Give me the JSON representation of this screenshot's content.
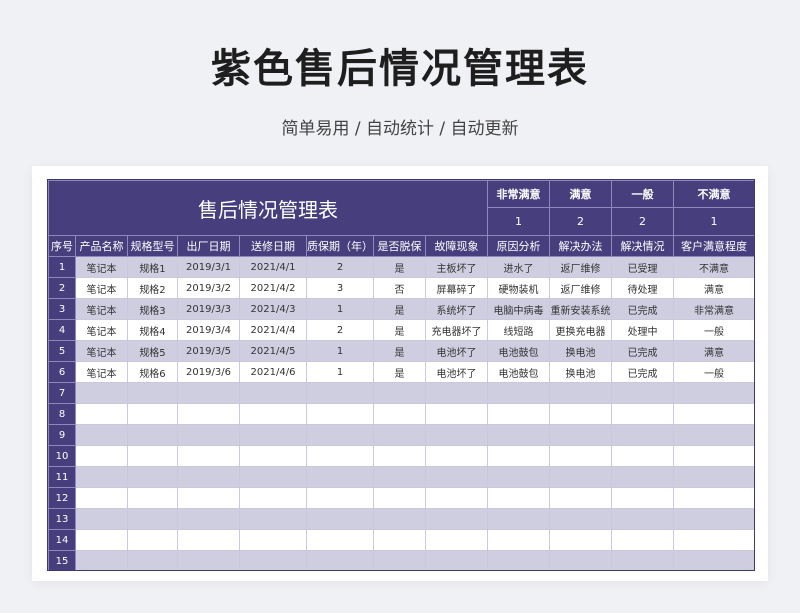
{
  "page": {
    "title": "紫色售后情况管理表",
    "subtitle": "简单易用 / 自动统计 / 自动更新"
  },
  "sheet": {
    "main_title": "售后情况管理表",
    "satisfaction": [
      {
        "label": "非常满意",
        "count": "1"
      },
      {
        "label": "满意",
        "count": "2"
      },
      {
        "label": "一般",
        "count": "2"
      },
      {
        "label": "不满意",
        "count": "1"
      }
    ],
    "columns": [
      "序号",
      "产品名称",
      "规格型号",
      "出厂日期",
      "送修日期",
      "质保期（年）",
      "是否脱保",
      "故障现象",
      "原因分析",
      "解决办法",
      "解决情况",
      "客户满意程度"
    ],
    "rows": [
      [
        "1",
        "笔记本",
        "规格1",
        "2019/3/1",
        "2021/4/1",
        "2",
        "是",
        "主板坏了",
        "进水了",
        "返厂维修",
        "已受理",
        "不满意"
      ],
      [
        "2",
        "笔记本",
        "规格2",
        "2019/3/2",
        "2021/4/2",
        "3",
        "否",
        "屏幕碎了",
        "硬物装机",
        "返厂维修",
        "待处理",
        "满意"
      ],
      [
        "3",
        "笔记本",
        "规格3",
        "2019/3/3",
        "2021/4/3",
        "1",
        "是",
        "系统坏了",
        "电脑中病毒",
        "重新安装系统",
        "已完成",
        "非常满意"
      ],
      [
        "4",
        "笔记本",
        "规格4",
        "2019/3/4",
        "2021/4/4",
        "2",
        "是",
        "充电器坏了",
        "线短路",
        "更换充电器",
        "处理中",
        "一般"
      ],
      [
        "5",
        "笔记本",
        "规格5",
        "2019/3/5",
        "2021/4/5",
        "1",
        "是",
        "电池坏了",
        "电池鼓包",
        "换电池",
        "已完成",
        "满意"
      ],
      [
        "6",
        "笔记本",
        "规格6",
        "2019/3/6",
        "2021/4/6",
        "1",
        "是",
        "电池坏了",
        "电池鼓包",
        "换电池",
        "已完成",
        "一般"
      ],
      [
        "7",
        "",
        "",
        "",
        "",
        "",
        "",
        "",
        "",
        "",
        "",
        ""
      ],
      [
        "8",
        "",
        "",
        "",
        "",
        "",
        "",
        "",
        "",
        "",
        "",
        ""
      ],
      [
        "9",
        "",
        "",
        "",
        "",
        "",
        "",
        "",
        "",
        "",
        "",
        ""
      ],
      [
        "10",
        "",
        "",
        "",
        "",
        "",
        "",
        "",
        "",
        "",
        "",
        ""
      ],
      [
        "11",
        "",
        "",
        "",
        "",
        "",
        "",
        "",
        "",
        "",
        "",
        ""
      ],
      [
        "12",
        "",
        "",
        "",
        "",
        "",
        "",
        "",
        "",
        "",
        "",
        ""
      ],
      [
        "13",
        "",
        "",
        "",
        "",
        "",
        "",
        "",
        "",
        "",
        "",
        ""
      ],
      [
        "14",
        "",
        "",
        "",
        "",
        "",
        "",
        "",
        "",
        "",
        "",
        ""
      ],
      [
        "15",
        "",
        "",
        "",
        "",
        "",
        "",
        "",
        "",
        "",
        "",
        ""
      ]
    ]
  }
}
